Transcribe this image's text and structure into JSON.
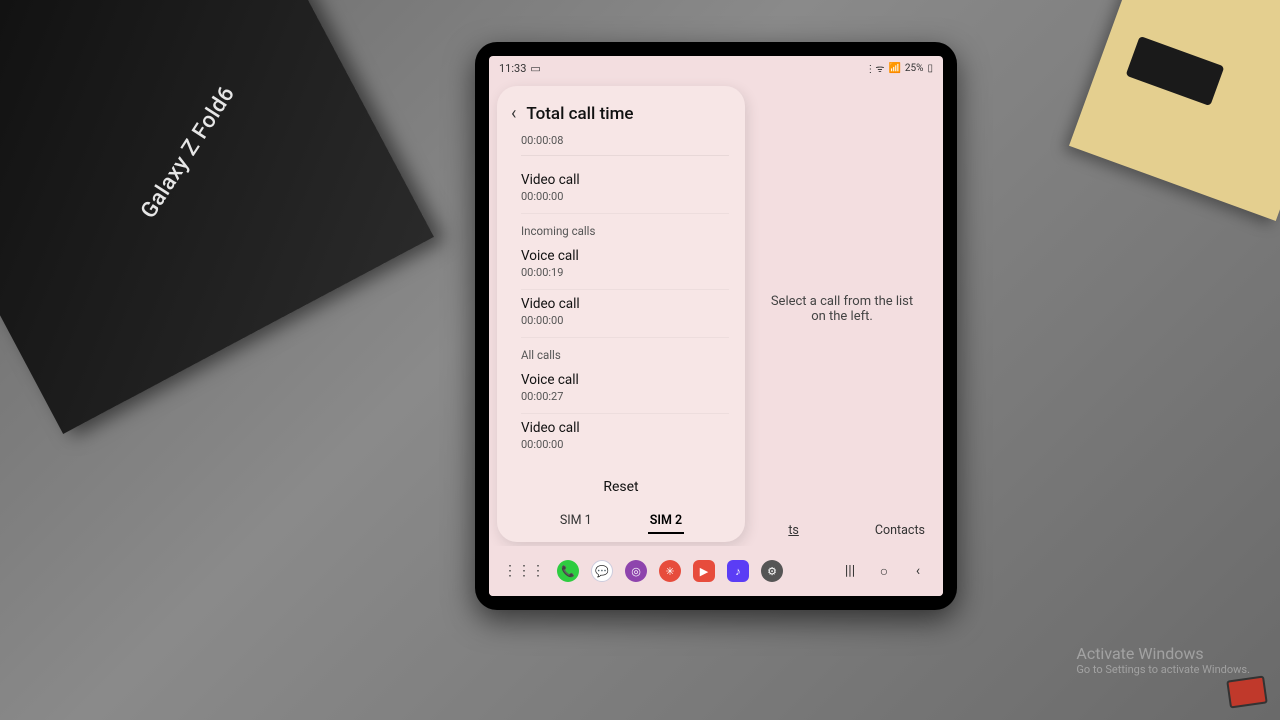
{
  "desk": {
    "box_label": "Galaxy Z Fold6"
  },
  "status": {
    "time": "11:33",
    "battery": "25%"
  },
  "panel": {
    "title": "Total call time",
    "top_value": "00:00:08",
    "outgoing": {
      "video": {
        "label": "Video call",
        "value": "00:00:00"
      }
    },
    "incoming": {
      "header": "Incoming calls",
      "voice": {
        "label": "Voice call",
        "value": "00:00:19"
      },
      "video": {
        "label": "Video call",
        "value": "00:00:00"
      }
    },
    "all": {
      "header": "All calls",
      "voice": {
        "label": "Voice call",
        "value": "00:00:27"
      },
      "video": {
        "label": "Video call",
        "value": "00:00:00"
      }
    },
    "reset_label": "Reset",
    "sim_tabs": {
      "sim1": "SIM 1",
      "sim2": "SIM 2",
      "active": "sim2"
    }
  },
  "right_pane": {
    "placeholder": "Select a call from the list on the left."
  },
  "bottom_tabs": {
    "peek": "ts",
    "contacts": "Contacts"
  },
  "watermark": {
    "title": "Activate Windows",
    "subtitle": "Go to Settings to activate Windows."
  },
  "dock": {
    "colors": {
      "phone": "#2ecc40",
      "messages": "#2b6cff",
      "bixby": "#8e44ad",
      "life": "#d46ac0",
      "tube": "#e74c3c",
      "music": "#5b3df5",
      "settings": "#555"
    }
  }
}
